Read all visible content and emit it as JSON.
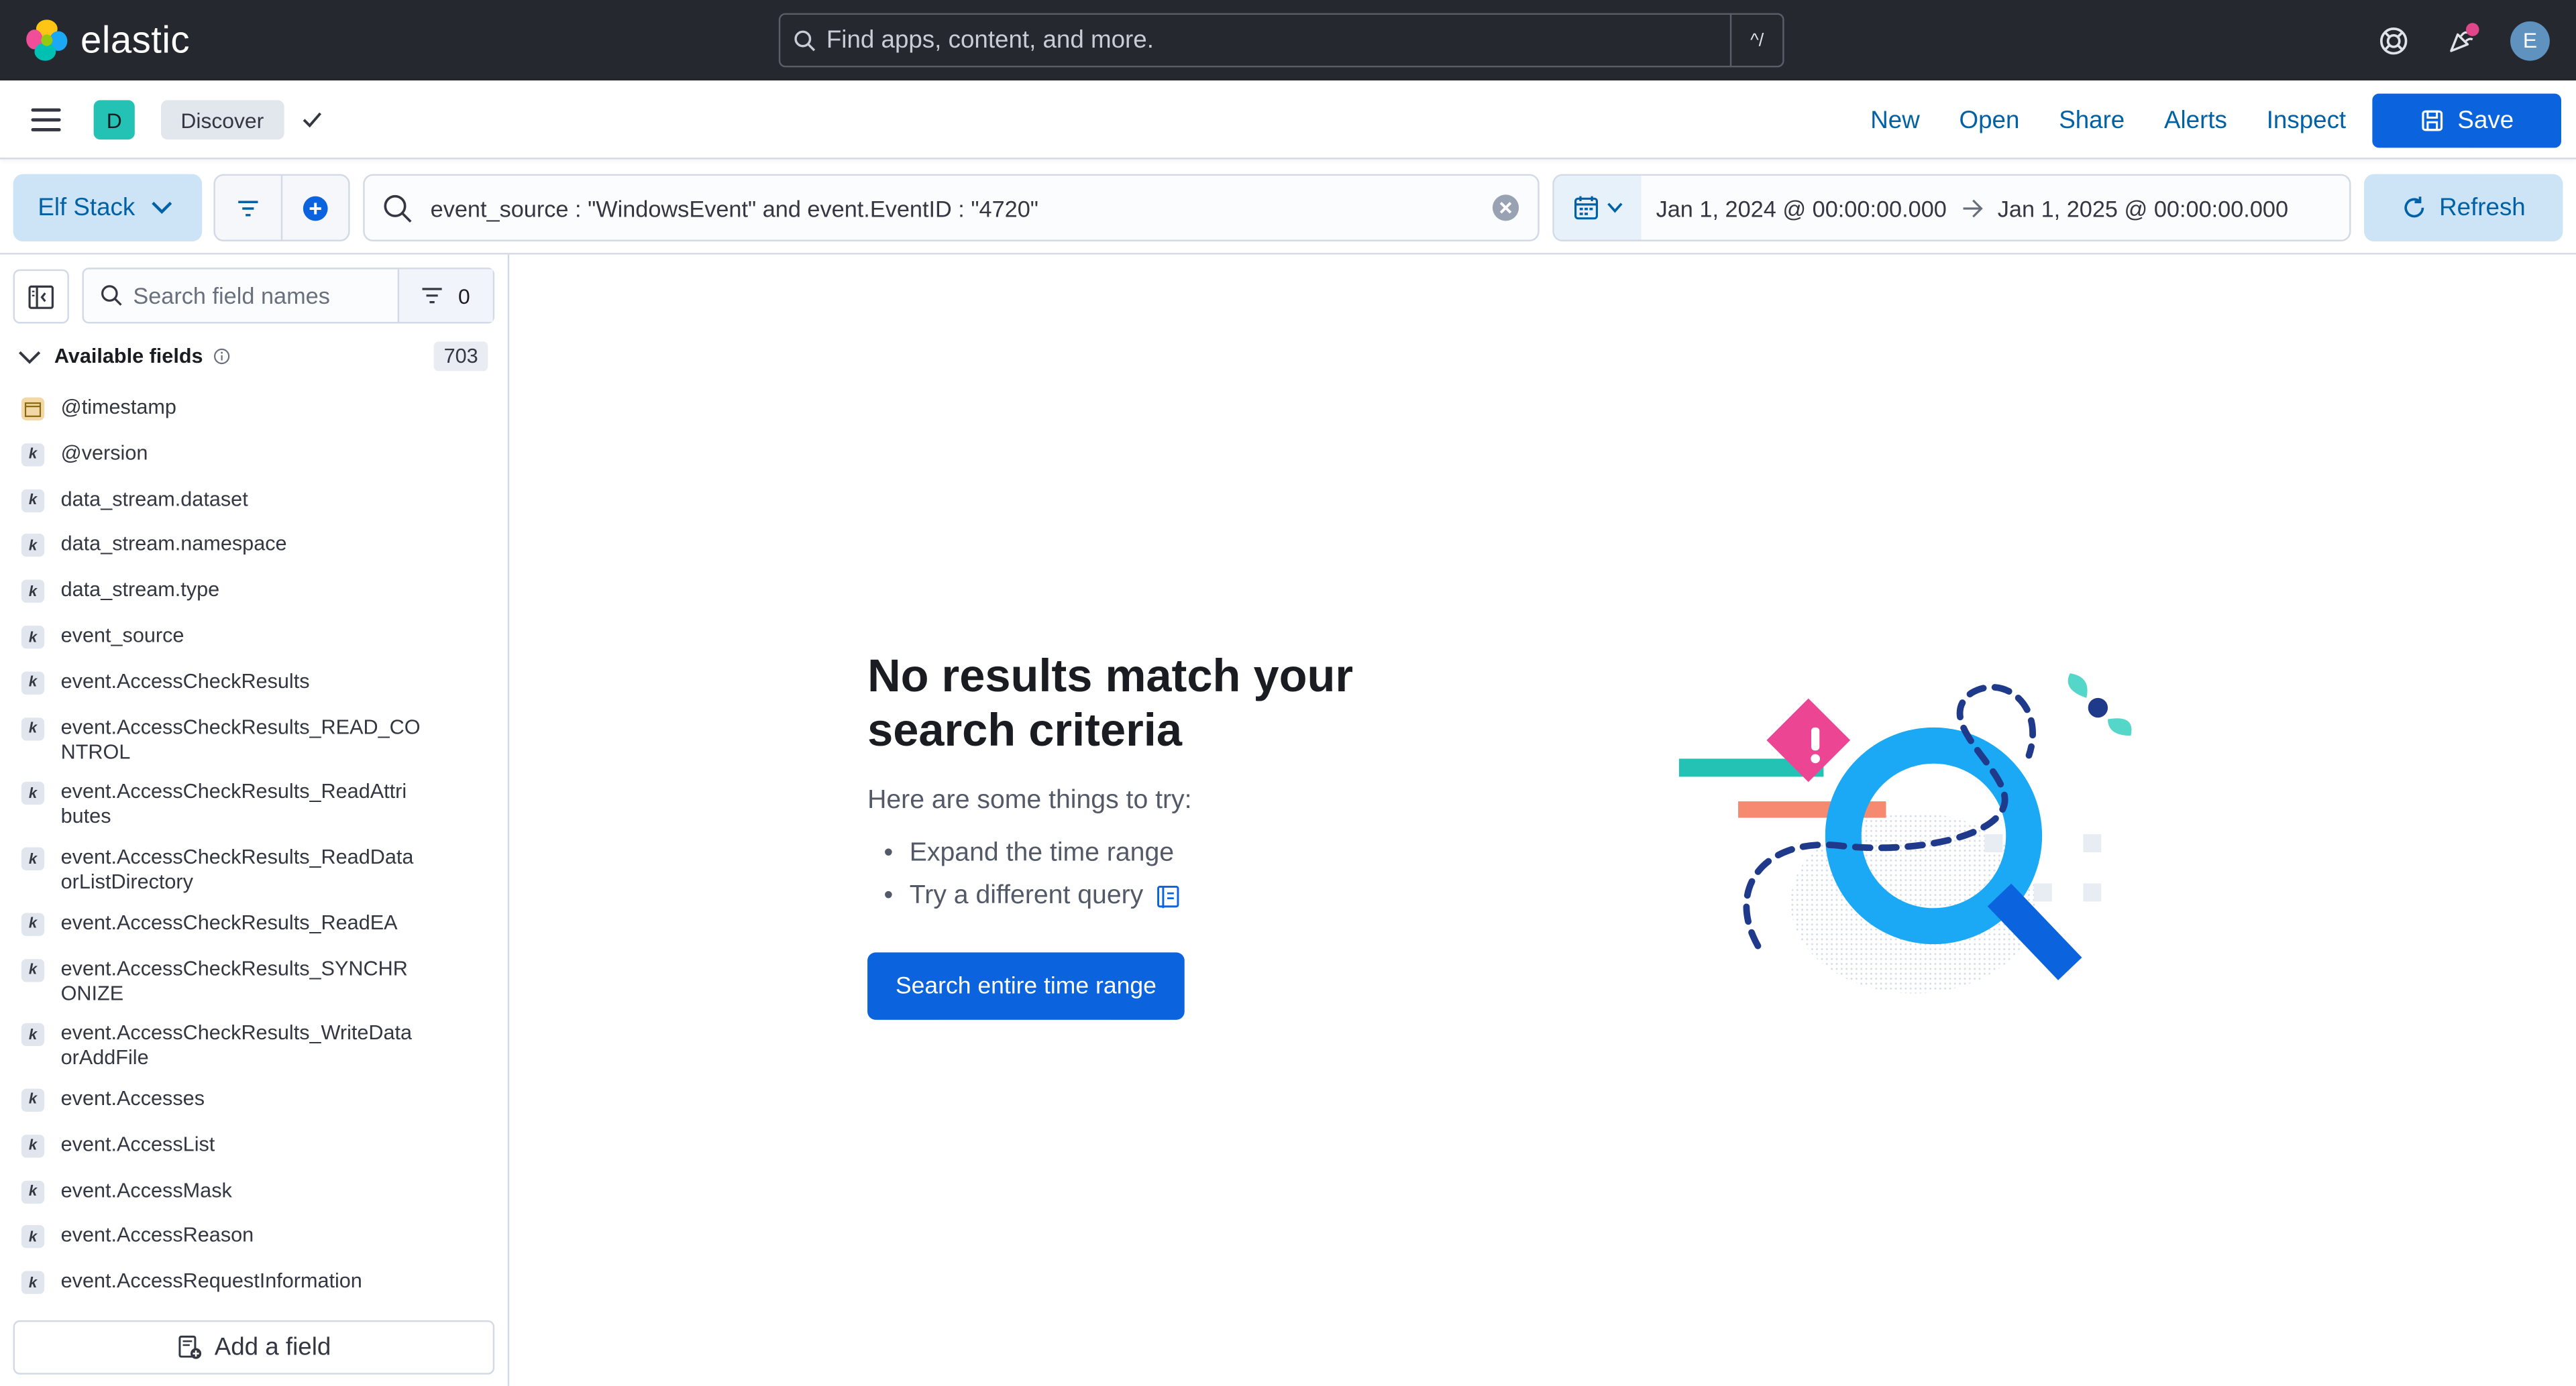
{
  "header": {
    "brand": "elastic",
    "search_placeholder": "Find apps, content, and more.",
    "search_shortcut": "^/",
    "avatar_initial": "E",
    "notification_color": "#e0468a"
  },
  "appbar": {
    "space_initial": "D",
    "breadcrumb": "Discover",
    "links": [
      "New",
      "Open",
      "Share",
      "Alerts",
      "Inspect"
    ],
    "save_label": "Save"
  },
  "querybar": {
    "data_view": "Elf Stack",
    "query": "event_source : \"WindowsEvent\" and event.EventID : \"4720\"",
    "start_date": "Jan 1, 2024 @ 00:00:00.000",
    "end_date": "Jan 1, 2025 @ 00:00:00.000",
    "refresh_label": "Refresh"
  },
  "sidebar": {
    "search_placeholder": "Search field names",
    "filter_count": "0",
    "available_label": "Available fields",
    "available_count": "703",
    "fields": [
      {
        "name": "@timestamp",
        "type": "date"
      },
      {
        "name": "@version",
        "type": "k"
      },
      {
        "name": "data_stream.dataset",
        "type": "k"
      },
      {
        "name": "data_stream.namespace",
        "type": "k"
      },
      {
        "name": "data_stream.type",
        "type": "k"
      },
      {
        "name": "event_source",
        "type": "k"
      },
      {
        "name": "event.AccessCheckResults",
        "type": "k"
      },
      {
        "name": "event.AccessCheckResults_READ_CO NTROL",
        "type": "k",
        "lines": [
          "event.AccessCheckResults_READ_CO",
          "NTROL"
        ]
      },
      {
        "name": "event.AccessCheckResults_ReadAttri butes",
        "type": "k",
        "lines": [
          "event.AccessCheckResults_ReadAttri",
          "butes"
        ]
      },
      {
        "name": "event.AccessCheckResults_ReadData orListDirectory",
        "type": "k",
        "lines": [
          "event.AccessCheckResults_ReadData",
          "orListDirectory"
        ]
      },
      {
        "name": "event.AccessCheckResults_ReadEA",
        "type": "k"
      },
      {
        "name": "event.AccessCheckResults_SYNCHR ONIZE",
        "type": "k",
        "lines": [
          "event.AccessCheckResults_SYNCHR",
          "ONIZE"
        ]
      },
      {
        "name": "event.AccessCheckResults_WriteData orAddFile",
        "type": "k",
        "lines": [
          "event.AccessCheckResults_WriteData",
          "orAddFile"
        ]
      },
      {
        "name": "event.Accesses",
        "type": "k"
      },
      {
        "name": "event.AccessList",
        "type": "k"
      },
      {
        "name": "event.AccessMask",
        "type": "k"
      },
      {
        "name": "event.AccessReason",
        "type": "k"
      },
      {
        "name": "event.AccessRequestInformation",
        "type": "k"
      }
    ],
    "add_field_label": "Add a field"
  },
  "main": {
    "title": "No results match your search criteria",
    "subtitle": "Here are some things to try:",
    "tips": [
      "Expand the time range",
      "Try a different query"
    ],
    "button_label": "Search entire time range"
  }
}
